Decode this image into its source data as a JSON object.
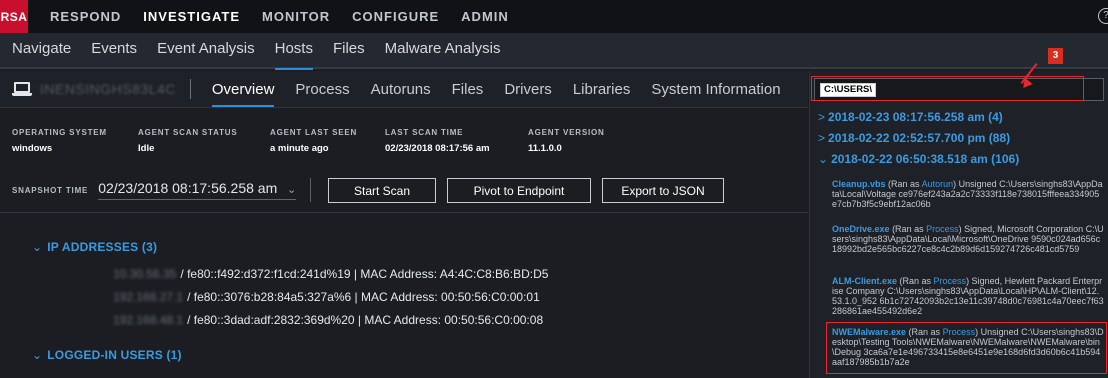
{
  "topnav": {
    "logo": "RSA",
    "items": [
      "RESPOND",
      "INVESTIGATE",
      "MONITOR",
      "CONFIGURE",
      "ADMIN"
    ],
    "active": "INVESTIGATE",
    "help_icon": "help-circle-icon"
  },
  "subnav": {
    "tabs": [
      "Navigate",
      "Events",
      "Event Analysis",
      "Hosts",
      "Files",
      "Malware Analysis"
    ],
    "active": "Hosts"
  },
  "host": {
    "name": "INENSINGHS83L4C",
    "icon": "laptop-icon",
    "tabs": [
      "Overview",
      "Process",
      "Autoruns",
      "Files",
      "Drivers",
      "Libraries",
      "System Information"
    ],
    "active_tab": "Overview"
  },
  "info": {
    "os_label": "OPERATING SYSTEM",
    "os_value": "windows",
    "scan_status_label": "AGENT SCAN STATUS",
    "scan_status_value": "Idle",
    "last_seen_label": "AGENT LAST SEEN",
    "last_seen_value": "a minute ago",
    "last_scan_label": "LAST SCAN TIME",
    "last_scan_value": "02/23/2018 08:17:56 am",
    "version_label": "AGENT VERSION",
    "version_value": "11.1.0.0"
  },
  "snapshot": {
    "label": "SNAPSHOT TIME",
    "value": "02/23/2018 08:17:56.258 am"
  },
  "buttons": {
    "start_scan": "Start Scan",
    "pivot": "Pivot to Endpoint",
    "export": "Export to JSON"
  },
  "ip": {
    "header": "IP ADDRESSES (3)",
    "rows": [
      {
        "ipv4": "10.30.56.35",
        "text": "/ fe80::f492:d372:f1cd:241d%19  |  MAC Address: A4:4C:C8:B6:BD:D5"
      },
      {
        "ipv4": "192.168.27.1",
        "text": "/ fe80::3076:b28:84a5:327a%6  |  MAC Address: 00:50:56:C0:00:01"
      },
      {
        "ipv4": "192.168.48.1",
        "text": "/ fe80::3dad:adf:2832:369d%20  |  MAC Address: 00:50:56:C0:00:08"
      }
    ]
  },
  "users": {
    "header": "LOGGED-IN USERS (1)"
  },
  "search": {
    "pill": "C:\\USERS\\"
  },
  "annotation": {
    "badge": "3"
  },
  "snapshots": [
    {
      "label": "2018-02-23 08:17:56.258 am (4)",
      "expanded": false
    },
    {
      "label": "2018-02-22 02:52:57.700 pm (88)",
      "expanded": false
    },
    {
      "label": "2018-02-22 06:50:38.518 am (106)",
      "expanded": true
    }
  ],
  "entries": [
    {
      "name": "Cleanup.vbs",
      "pre": "(Ran as ",
      "link": "Autorun",
      "post": ")  Unsigned    C:\\Users\\singhs83\\AppData\\Local\\Voltage    ce976ef243a2a2c73333f118e738015fffeea334905e7cb7b3f5c9ebf12ac06b"
    },
    {
      "name": "OneDrive.exe",
      "pre": "(Ran as ",
      "link": "Process",
      "post": ")  Signed, Microsoft Corporation  C:\\Users\\singhs83\\AppData\\Local\\Microsoft\\OneDrive    9590c024ad656c18992bd2e565bc6227ce8c4c2b89d6d159274726c481cd5759"
    },
    {
      "name": "ALM-Client.exe",
      "pre": "(Ran as ",
      "link": "Process",
      "post": ")  Signed, Hewlett Packard Enterprise Company    C:\\Users\\singhs83\\AppData\\Local\\HP\\ALM-Client\\12.53.1.0_952    6b1c72742093b2c13e11c39748d0c76981c4a70eec7f63286861ae455492d6e2"
    },
    {
      "name": "NWEMalware.exe",
      "pre": "(Ran as ",
      "link": "Process",
      "post": ")  Unsigned    C:\\Users\\singhs83\\Desktop\\Testing Tools\\NWEMalware\\NWEMalware\\NWEMalware\\bin\\Debug    3ca6a7e1e496733415e8e6451e9e168d6fd3d60b6c41b594aaf187985b1b7a2e"
    }
  ]
}
